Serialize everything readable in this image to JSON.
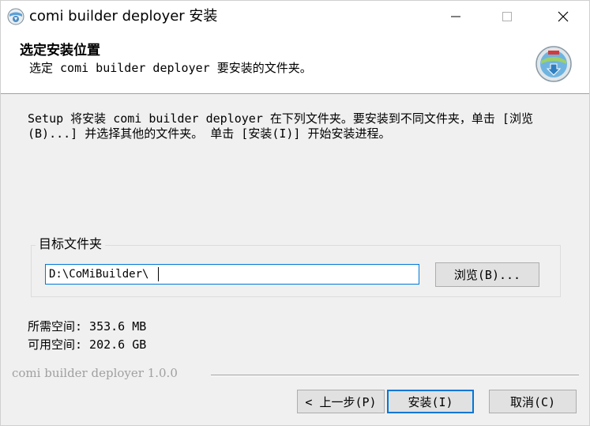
{
  "window": {
    "title": "comi builder deployer 安装",
    "icon": "installer-app-icon",
    "controls": {
      "minimize": "minimize-icon",
      "maximize": "maximize-icon",
      "close": "close-icon"
    }
  },
  "header": {
    "title": "选定安装位置",
    "subtitle": "选定 comi builder deployer 要安装的文件夹。",
    "icon": "installer-disk-icon"
  },
  "body": {
    "description": "Setup 将安装 comi builder deployer 在下列文件夹。要安装到不同文件夹，单击 [浏览(B)...] 并选择其他的文件夹。 单击 [安装(I)] 开始安装进程。",
    "target_group_label": "目标文件夹",
    "folder_path": "D:\\CoMiBuilder\\",
    "browse_label": "浏览(B)...",
    "space_required": "所需空间: 353.6 MB",
    "space_available": "可用空间: 202.6 GB"
  },
  "footer": {
    "brand": "comi builder deployer 1.0.0",
    "back_label": "< 上一步(P)",
    "install_label": "安装(I)",
    "cancel_label": "取消(C)"
  },
  "colors": {
    "accent": "#0078d7",
    "background": "#f0f0f0",
    "button_face": "#e1e1e1"
  }
}
